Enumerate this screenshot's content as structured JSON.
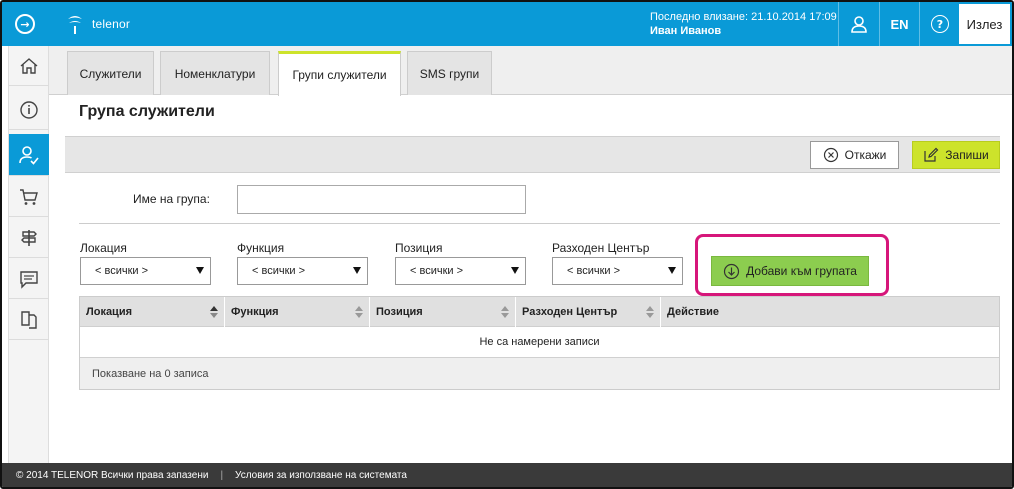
{
  "topbar": {
    "logo_text": "telenor",
    "last_login_label": "Последно влизане: 21.10.2014 17:09",
    "user_name": "Иван Иванов",
    "lang": "EN",
    "logout": "Излез"
  },
  "sidebar": {
    "items": [
      {
        "icon": "home-icon"
      },
      {
        "icon": "info-icon"
      },
      {
        "icon": "user-check-icon",
        "active": true
      },
      {
        "icon": "cart-icon"
      },
      {
        "icon": "signpost-icon"
      },
      {
        "icon": "chat-icon"
      },
      {
        "icon": "documents-icon"
      }
    ]
  },
  "tabs": [
    {
      "label": "Служители"
    },
    {
      "label": "Номенклатури"
    },
    {
      "label": "Групи служители",
      "active": true
    },
    {
      "label": "SMS групи"
    }
  ],
  "page": {
    "title": "Група служители"
  },
  "actions": {
    "cancel_label": "Откажи",
    "save_label": "Запиши"
  },
  "form": {
    "group_name_label": "Име на група:",
    "group_name_value": "",
    "filters": [
      {
        "label": "Локация",
        "selected": "< всички >"
      },
      {
        "label": "Функция",
        "selected": "< всички >"
      },
      {
        "label": "Позиция",
        "selected": "< всички >"
      },
      {
        "label": "Разходен Център",
        "selected": "< всички >"
      }
    ],
    "add_to_group_label": "Добави към групата"
  },
  "table": {
    "columns": [
      "Локация",
      "Функция",
      "Позиция",
      "Разходен Център",
      "Действие"
    ],
    "empty_text": "Не са намерени записи",
    "footer_text": "Показване на 0 записа"
  },
  "footer": {
    "copyright": "© 2014 TELENOR Всички права запазени",
    "terms": "Условия за използване на системата"
  },
  "colors": {
    "brand_blue": "#0a9ad7",
    "accent_lime": "#cde32b",
    "add_green": "#8ccd4f",
    "highlight_pink": "#d6167a"
  }
}
